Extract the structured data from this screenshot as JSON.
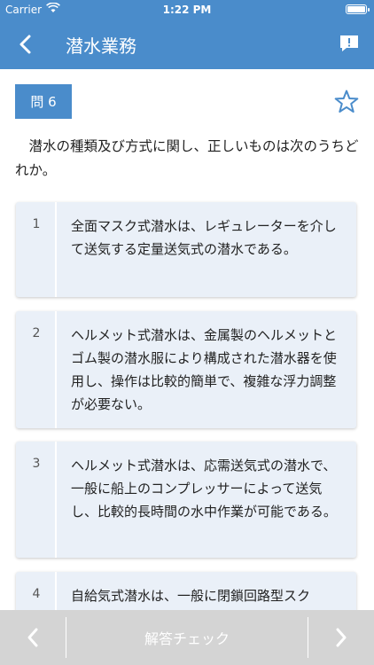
{
  "status_bar": {
    "carrier": "Carrier",
    "time": "1:22 PM"
  },
  "nav": {
    "title": "潜水業務",
    "back_icon": "chevron-left-icon",
    "report_icon": "report-bubble-icon"
  },
  "question": {
    "badge": "問 6",
    "text": "潜水の種類及び方式に関し、正しいものは次のうちどれか。",
    "favorite_icon": "star-outline-icon"
  },
  "choices": [
    {
      "number": "1",
      "text": "全面マスク式潜水は、レギュレーターを介して送気する定量送気式の潜水である。"
    },
    {
      "number": "2",
      "text": "ヘルメット式潜水は、金属製のヘルメットとゴム製の潜水服により構成された潜水器を使用し、操作は比較的簡単で、複雑な浮力調整が必要ない。"
    },
    {
      "number": "3",
      "text": "ヘルメット式潜水は、応需送気式の潜水で、一般に船上のコンプレッサーによって送気し、比較的長時間の水中作業が可能である。"
    },
    {
      "number": "4",
      "text": "自給気式潜水は、一般に閉鎖回路型スク"
    }
  ],
  "footer": {
    "check_label": "解答チェック",
    "prev_icon": "chevron-left-icon",
    "next_icon": "chevron-right-icon"
  },
  "colors": {
    "accent": "#4a8ccb",
    "choice_bg": "#eaf0f8",
    "footer_bg": "#d4d4d4"
  }
}
